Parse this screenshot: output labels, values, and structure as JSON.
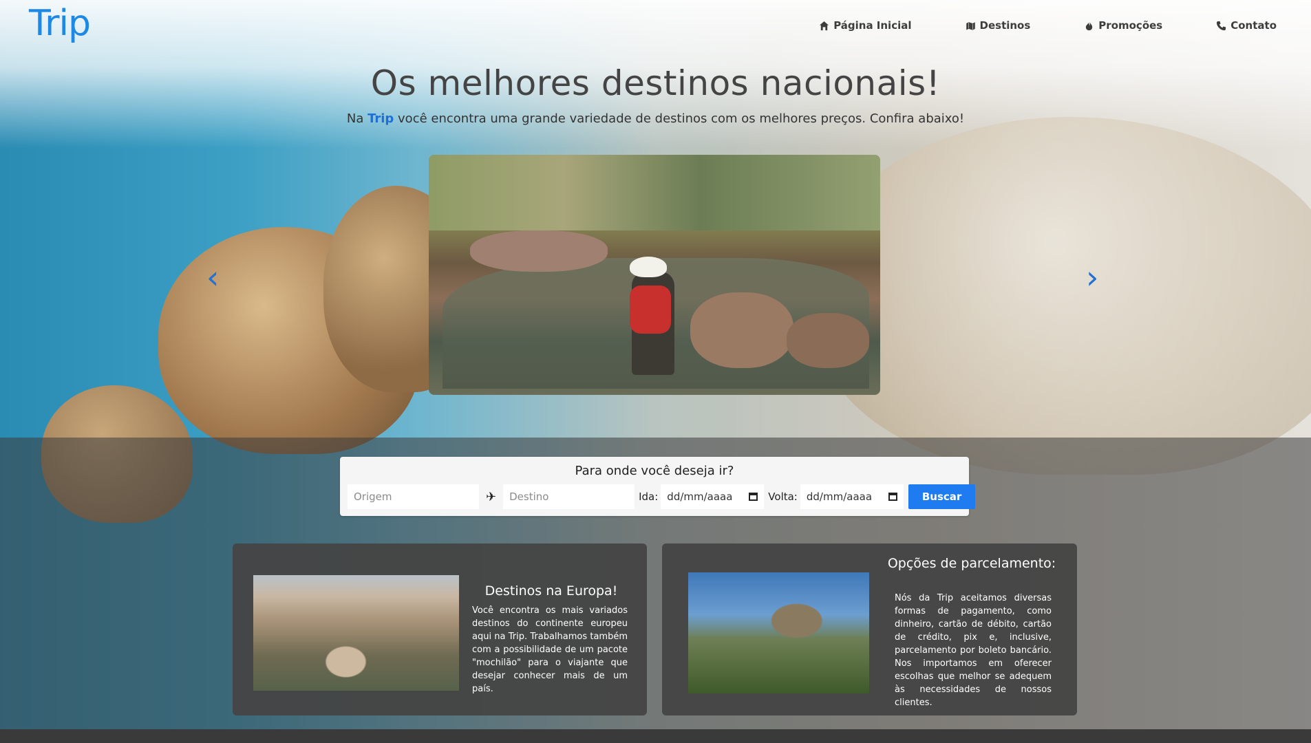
{
  "header": {
    "logo": "Trip",
    "nav": [
      {
        "label": "Página Inicial",
        "icon": "home-icon"
      },
      {
        "label": "Destinos",
        "icon": "map-icon"
      },
      {
        "label": "Promoções",
        "icon": "fire-icon"
      },
      {
        "label": "Contato",
        "icon": "phone-icon"
      }
    ]
  },
  "hero": {
    "title": "Os melhores destinos nacionais!",
    "subtitle_pre": "Na ",
    "subtitle_brand": "Trip",
    "subtitle_post": " você encontra uma grande variedade de destinos com os melhores preços. Confira abaixo!"
  },
  "carousel": {
    "prev": "‹",
    "next": "›"
  },
  "search": {
    "question": "Para onde você deseja ir?",
    "origin_placeholder": "Origem",
    "destination_placeholder": "Destino",
    "ida_label": "Ida:",
    "ida_value": "dd/mm/aaaa",
    "volta_label": "Volta:",
    "volta_value": "dd/mm/aaaa",
    "button": "Buscar"
  },
  "cards": [
    {
      "title": "Destinos na Europa!",
      "text": "Você encontra os mais variados destinos do continente europeu aqui na Trip. Trabalhamos também com a possibilidade de um pacote \"mochilão\" para o viajante que desejar conhecer mais de um país."
    },
    {
      "title": "Opções de parcelamento:",
      "text": "Nós da Trip aceitamos diversas formas de pagamento, como dinheiro, cartão de débito, cartão de crédito, pix e, inclusive, parcelamento por boleto bancário. Nos importamos em oferecer escolhas que melhor se adequem às necessidades de nossos clientes."
    }
  ],
  "colors": {
    "brand": "#1e88e5",
    "button": "#1e7cf0",
    "card_bg": "#444444"
  }
}
